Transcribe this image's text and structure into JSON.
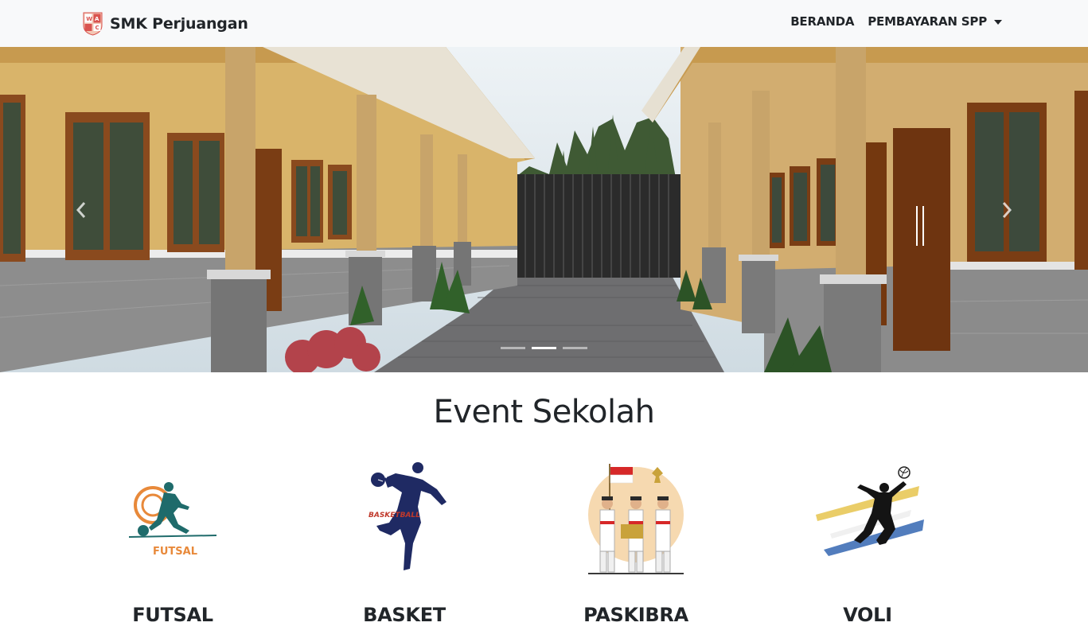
{
  "brand": {
    "name": "SMK Perjuangan",
    "logo_icon": "school-shield-logo"
  },
  "nav": {
    "items": [
      {
        "label": "BERANDA",
        "dropdown": false
      },
      {
        "label": "PEMBAYARAN SPP",
        "dropdown": true
      }
    ]
  },
  "carousel": {
    "slide_count": 3,
    "active_slide": 2,
    "prev_icon": "chevron-left-icon",
    "next_icon": "chevron-right-icon"
  },
  "events": {
    "title": "Event Sekolah",
    "items": [
      {
        "label": "FUTSAL",
        "icon": "futsal-player-icon",
        "caption": "FUTSAL"
      },
      {
        "label": "BASKET",
        "icon": "basketball-player-icon",
        "caption": "BASKETBALL"
      },
      {
        "label": "PASKIBRA",
        "icon": "flag-raising-team-icon",
        "caption": ""
      },
      {
        "label": "VOLI",
        "icon": "volleyball-player-icon",
        "caption": ""
      }
    ]
  },
  "colors": {
    "navbar_bg": "#f8f9fa",
    "text": "#212529",
    "futsal_accent": "#e8893a",
    "futsal_figure": "#1f6b6b",
    "basket_figure": "#1f2a63",
    "flag_red": "#d62828"
  }
}
